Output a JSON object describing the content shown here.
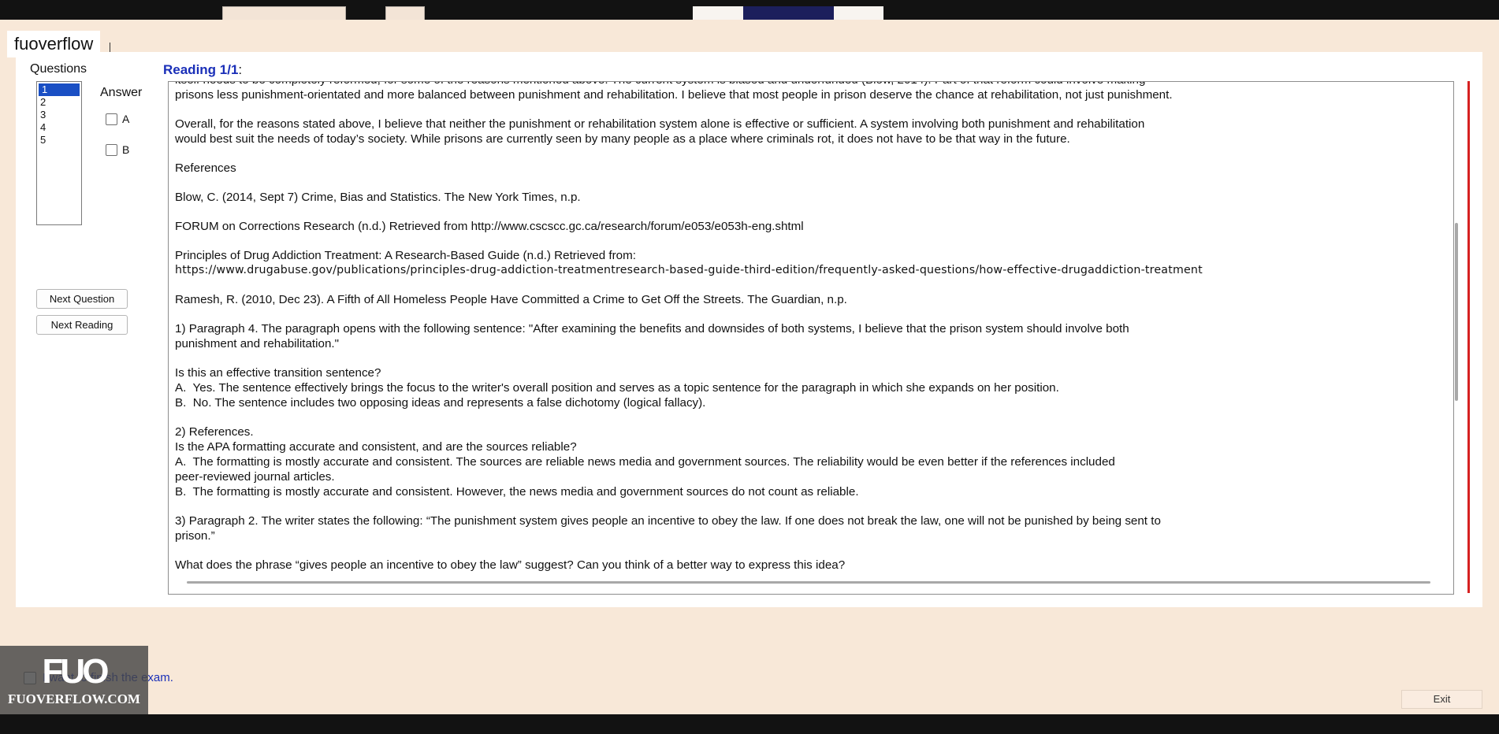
{
  "app": {
    "brand": "fuoverflow"
  },
  "questions": {
    "label": "Questions",
    "items": [
      "1",
      "2",
      "3",
      "4",
      "5"
    ],
    "selected": "1"
  },
  "answer": {
    "label": "Answer",
    "options": [
      "A",
      "B"
    ]
  },
  "buttons": {
    "next_question": "Next Question",
    "next_reading": "Next Reading",
    "exit": "Exit"
  },
  "reading": {
    "title": "Reading 1/1",
    "title_suffix": ":",
    "paragraphs": [
      "itself needs to be completely reformed, for some of the reasons mentioned above. The current system is biased and underfunded (Blow, 2014). Part of that reform could involve making\nprisons less punishment-orientated and more balanced between punishment and rehabilitation. I believe that most people in prison deserve the chance at rehabilitation, not just punishment.",
      "Overall, for the reasons stated above, I believe that neither the punishment or rehabilitation system alone is effective or sufficient. A system involving both punishment and rehabilitation\nwould best suit the needs of today’s society. While prisons are currently seen by many people as a place where criminals rot, it does not have to be that way in the future.",
      "References",
      "Blow, C. (2014, Sept 7) Crime, Bias and Statistics. The New York Times, n.p.",
      "FORUM on Corrections Research (n.d.) Retrieved from http://www.cscscc.gc.ca/research/forum/e053/e053h-eng.shtml"
    ],
    "ref_principles_line1": "Principles of Drug Addiction Treatment: A Research-Based Guide (n.d.) Retrieved from:",
    "ref_principles_url": "https://www.drugabuse.gov/publications/principles-drug-addiction-treatmentresearch-based-guide-third-edition/frequently-asked-questions/how-effective-drugaddiction-treatment",
    "ref_ramesh": "Ramesh, R. (2010, Dec 23). A Fifth of All Homeless People Have Committed a Crime to Get Off the Streets. The Guardian, n.p.",
    "q1_prompt": "1) Paragraph 4. The paragraph opens with the following sentence: \"After examining the benefits and downsides of both systems, I believe that the prison system should involve both\npunishment and rehabilitation.\"",
    "q1_question": "Is this an effective transition sentence?",
    "q1_a": "A.  Yes. The sentence effectively brings the focus to the writer's overall position and serves as a topic sentence for the paragraph in which she expands on her position.",
    "q1_b": "B.  No. The sentence includes two opposing ideas and represents a false dichotomy (logical fallacy).",
    "q2_prompt": "2) References.",
    "q2_question": "Is the APA formatting accurate and consistent, and are the sources reliable?",
    "q2_a": "A.  The formatting is mostly accurate and consistent. The sources are reliable news media and government sources. The reliability would be even better if the references included\npeer-reviewed journal articles.",
    "q2_b": "B.  The formatting is mostly accurate and consistent. However, the news media and government sources do not count as reliable.",
    "q3_prompt": "3) Paragraph 2. The writer states the following: “The punishment system gives people an incentive to obey the law. If one does not break the law, one will not be punished by being sent to\nprison.”",
    "q3_question": "What does the phrase “gives people an incentive to obey the law” suggest? Can you think of a better way to express this idea?"
  },
  "finish": {
    "label": "I want to finish the exam."
  },
  "watermark": {
    "logo": "FUO",
    "site": "FUOVERFLOW.COM"
  }
}
